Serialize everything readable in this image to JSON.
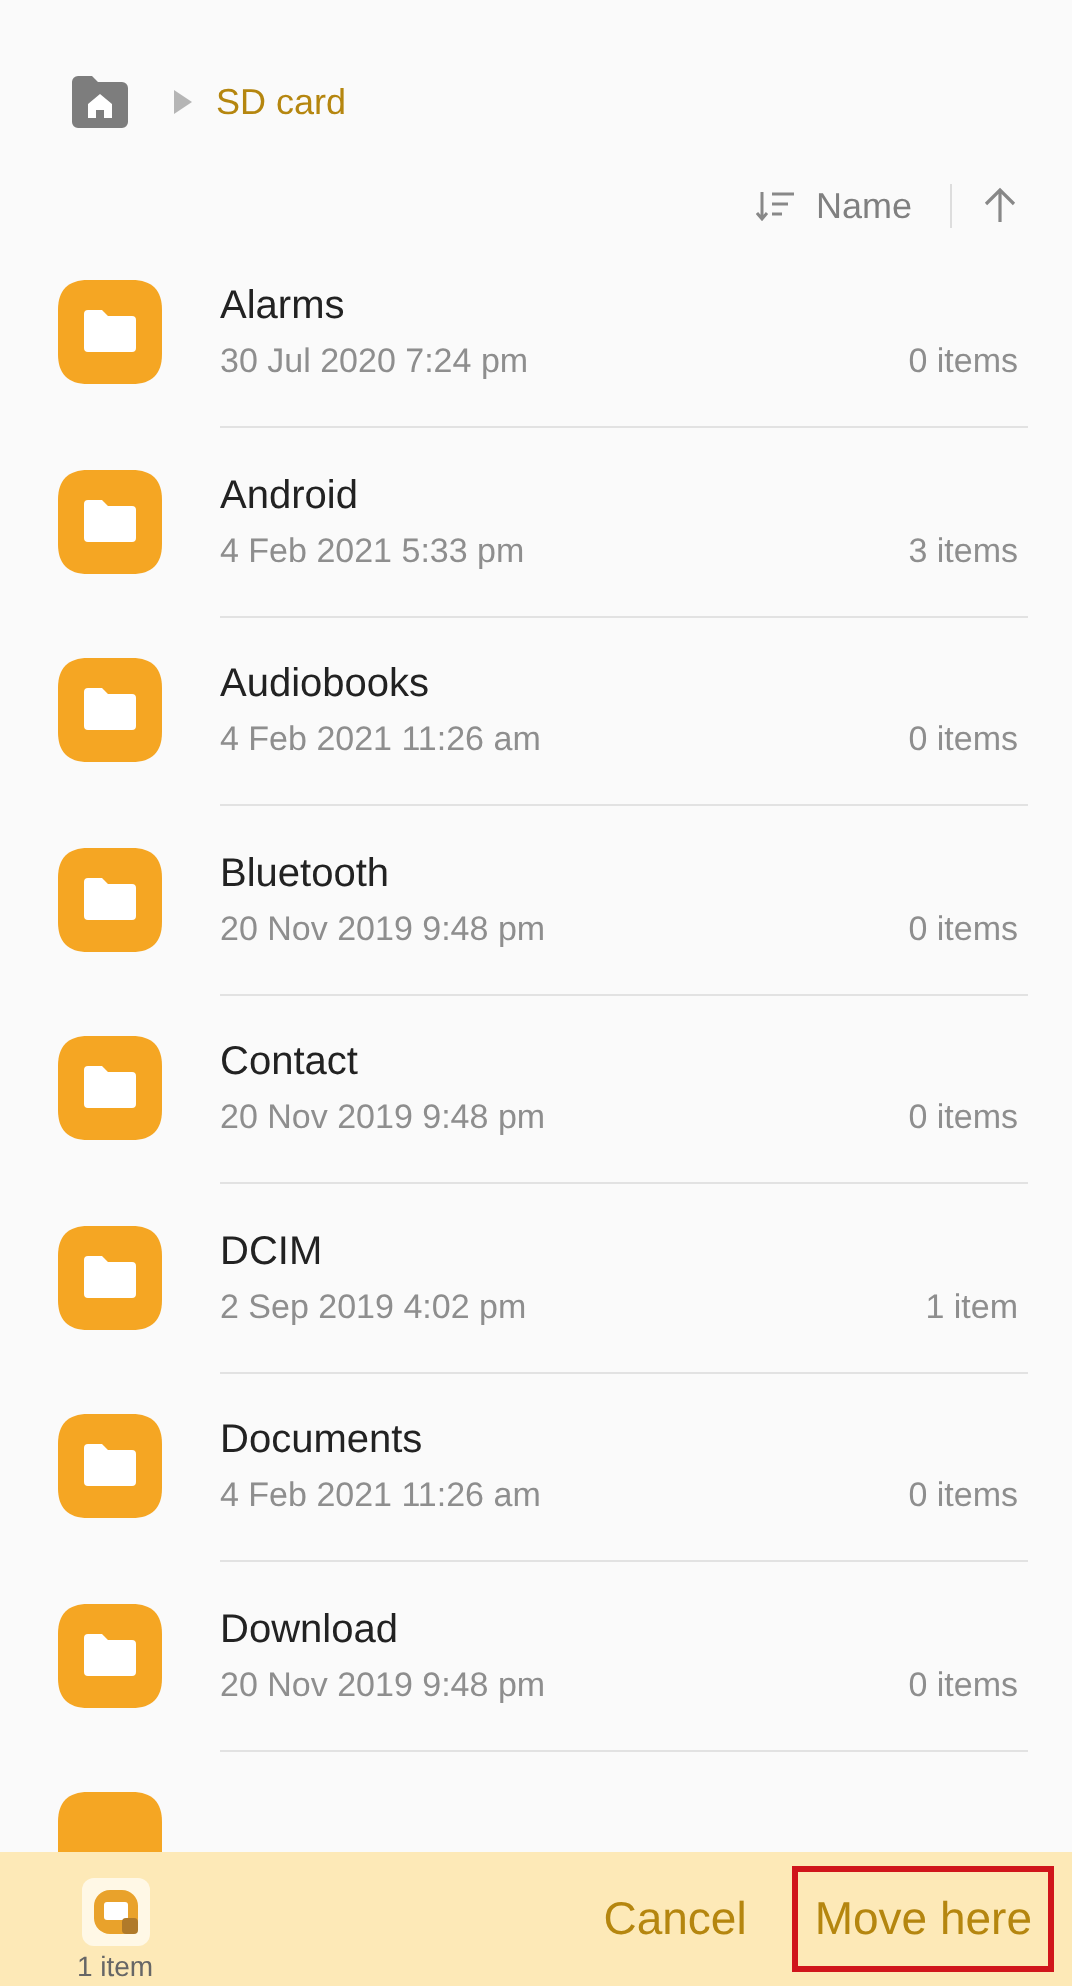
{
  "breadcrumb": {
    "items": [
      "SD card"
    ]
  },
  "sort": {
    "label": "Name",
    "ascending": true
  },
  "folders": [
    {
      "name": "Alarms",
      "date": "30 Jul 2020 7:24 pm",
      "count": "0 items"
    },
    {
      "name": "Android",
      "date": "4 Feb 2021 5:33 pm",
      "count": "3 items"
    },
    {
      "name": "Audiobooks",
      "date": "4 Feb 2021 11:26 am",
      "count": "0 items"
    },
    {
      "name": "Bluetooth",
      "date": "20 Nov 2019 9:48 pm",
      "count": "0 items"
    },
    {
      "name": "Contact",
      "date": "20 Nov 2019 9:48 pm",
      "count": "0 items"
    },
    {
      "name": "DCIM",
      "date": "2 Sep 2019 4:02 pm",
      "count": "1 item"
    },
    {
      "name": "Documents",
      "date": "4 Feb 2021 11:26 am",
      "count": "0 items"
    },
    {
      "name": "Download",
      "date": "20 Nov 2019 9:48 pm",
      "count": "0 items"
    }
  ],
  "bottom_bar": {
    "selection_count": "1 item",
    "buttons": [
      {
        "label": "Cancel",
        "highlighted": false
      },
      {
        "label": "Move here",
        "highlighted": true
      }
    ]
  }
}
